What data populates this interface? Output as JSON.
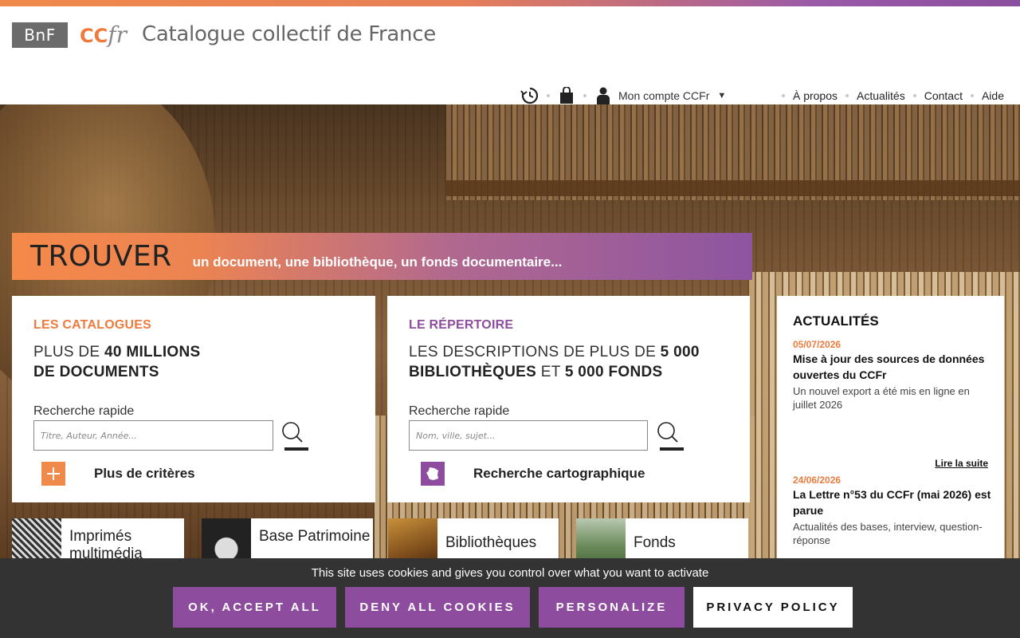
{
  "header": {
    "logo_bnf": "BnF",
    "logo_ccfr_cc": "CC",
    "logo_ccfr_fr": "fr",
    "site_title": "Catalogue collectif de France"
  },
  "user_nav": {
    "history_icon": "history-icon",
    "basket_icon": "basket-icon",
    "user_icon": "user-icon",
    "account_label": "Mon compte CCFr"
  },
  "info_nav": {
    "links": [
      "À propos",
      "Actualités",
      "Contact",
      "Aide"
    ]
  },
  "hero": {
    "title": "TROUVER",
    "subtitle": "un document, une bibliothèque, un fonds documentaire..."
  },
  "catalogues": {
    "kicker": "LES CATALOGUES",
    "headline_1_pre": "PLUS DE ",
    "headline_1_bold": "40 MILLIONS",
    "headline_2_bold": "DE DOCUMENTS",
    "quick_label": "Recherche rapide",
    "placeholder": "Titre, Auteur, Année...",
    "extra_label": "Plus de critères"
  },
  "repertoire": {
    "kicker": "LE RÉPERTOIRE",
    "headline_1_pre": "LES DESCRIPTIONS DE PLUS DE ",
    "headline_1_bold": "5 000",
    "headline_2_bold_a": "BIBLIOTHÈQUES",
    "headline_2_mid": " ET ",
    "headline_2_bold_b": "5 000 FONDS",
    "quick_label": "Recherche rapide",
    "placeholder": "Nom, ville, sujet...",
    "extra_label": "Recherche cartographique"
  },
  "news": {
    "title": "ACTUALITÉS",
    "items": [
      {
        "date": "05/07/2026",
        "title": "Mise à jour des sources de données ouvertes du CCFr",
        "desc": "Un nouvel export a été mis en ligne en juillet 2026"
      },
      {
        "date": "24/06/2026",
        "title": "La Lettre n°53 du CCFr (mai 2026) est parue",
        "desc": "Actualités des bases, interview, question-réponse"
      }
    ],
    "more_label": "Lire la suite"
  },
  "tiles": [
    {
      "label": "Imprimés multimédia"
    },
    {
      "label": "Base Patrimoine"
    },
    {
      "label": "Bibliothèques"
    },
    {
      "label": "Fonds"
    }
  ],
  "cookie_banner": {
    "message": "This site uses cookies and gives you control over what you want to activate",
    "accept": "OK, ACCEPT ALL",
    "deny": "DENY ALL COOKIES",
    "personalize": "PERSONALIZE",
    "policy": "PRIVACY POLICY"
  },
  "colors": {
    "orange": "#ec7b3e",
    "purple": "#8d4c9e",
    "cookie_bg": "#333333"
  }
}
